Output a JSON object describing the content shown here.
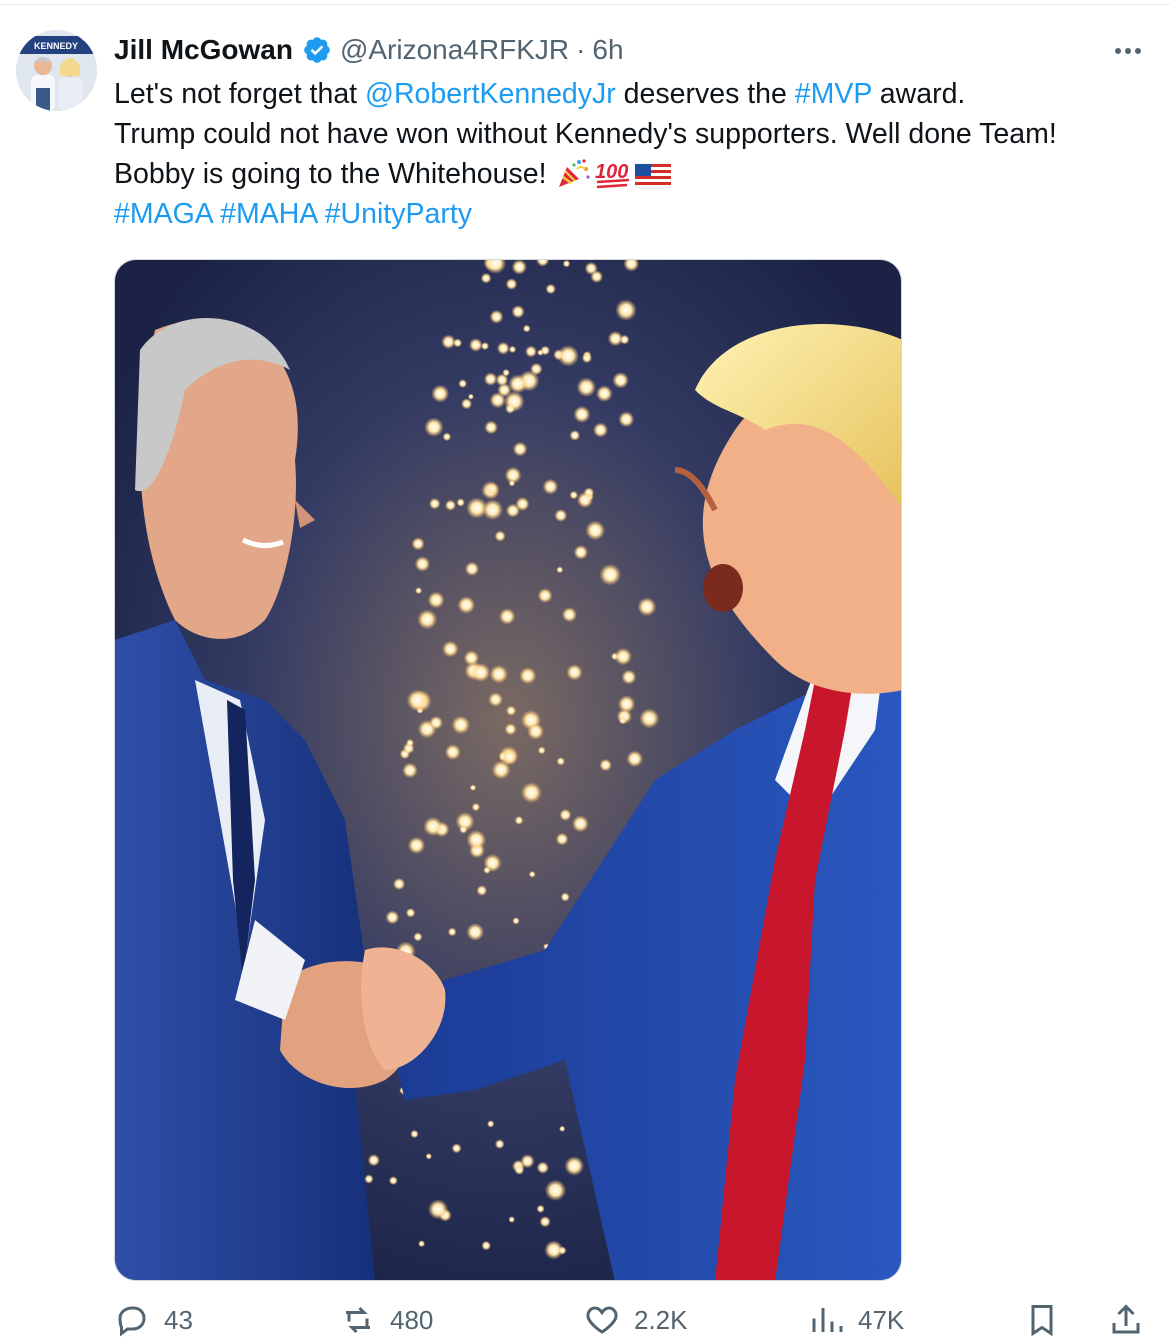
{
  "author": {
    "display_name": "Jill McGowan",
    "handle": "@Arizona4RFKJR",
    "separator": "·",
    "time": "6h",
    "verified": true,
    "avatar_sign_text": "KENNEDY"
  },
  "tweet": {
    "lines": [
      {
        "pre": "Let's not forget that ",
        "mention": "@RobertKennedyJr",
        "mid": " deserves the ",
        "hashtag": "#MVP",
        "post": " award."
      },
      {
        "text": "Trump could not have won without Kennedy's supporters. Well done Team!"
      },
      {
        "text": "Bobby is going to the Whitehouse! ",
        "emoji": [
          "party-popper",
          "hundred-points",
          "us-flag"
        ]
      },
      {
        "hashtags": [
          "#MAGA",
          "#MAHA",
          "#UnityParty"
        ]
      }
    ]
  },
  "media": {
    "description_icon": "photo-handshake-fireworks",
    "colors": {
      "suit": "#1c3f96",
      "tie": "#c8162c",
      "sparks": "#fff1c4",
      "background": "#2a3560"
    }
  },
  "actions": {
    "reply_count": "43",
    "repost_count": "480",
    "like_count": "2.2K",
    "views_count": "47K"
  },
  "colors": {
    "link": "#1d9bf0",
    "muted": "#536471",
    "text": "#0f1419",
    "verified": "#1d9bf0"
  }
}
